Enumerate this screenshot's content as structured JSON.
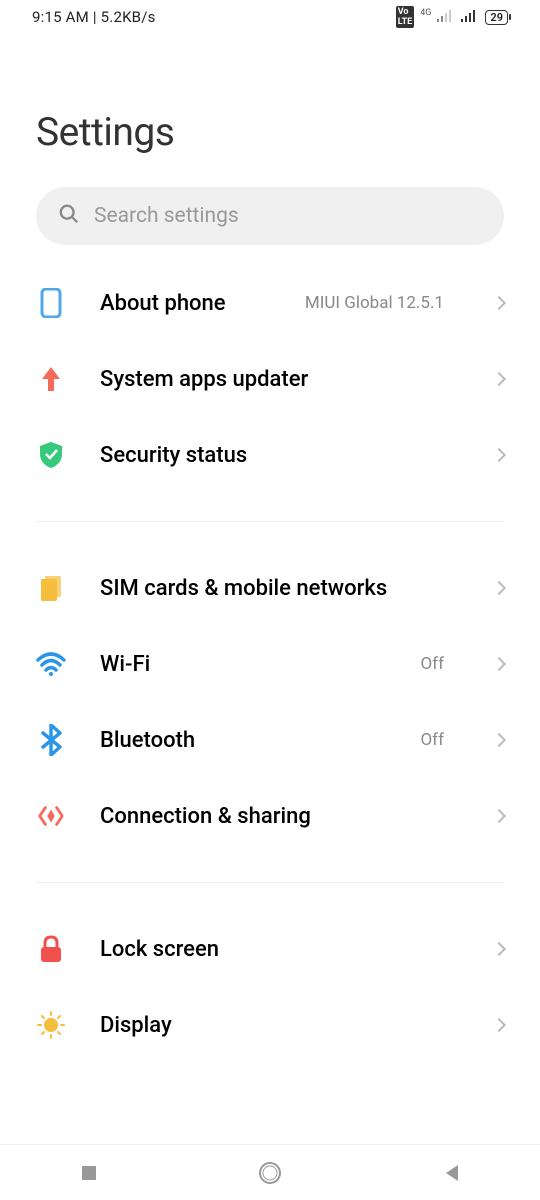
{
  "status": {
    "time": "9:15 AM",
    "speed": "5.2KB/s",
    "battery": "29",
    "network": "4G",
    "volte": "VoLTE"
  },
  "header": {
    "title": "Settings"
  },
  "search": {
    "placeholder": "Search settings"
  },
  "groups": [
    {
      "items": [
        {
          "icon": "phone",
          "label": "About phone",
          "value": "MIUI Global 12.5.1"
        },
        {
          "icon": "update",
          "label": "System apps updater",
          "value": ""
        },
        {
          "icon": "shield",
          "label": "Security status",
          "value": ""
        }
      ]
    },
    {
      "items": [
        {
          "icon": "sim",
          "label": "SIM cards & mobile networks",
          "value": ""
        },
        {
          "icon": "wifi",
          "label": "Wi-Fi",
          "value": "Off"
        },
        {
          "icon": "bluetooth",
          "label": "Bluetooth",
          "value": "Off"
        },
        {
          "icon": "connection",
          "label": "Connection & sharing",
          "value": ""
        }
      ]
    },
    {
      "items": [
        {
          "icon": "lock",
          "label": "Lock screen",
          "value": ""
        },
        {
          "icon": "display",
          "label": "Display",
          "value": ""
        }
      ]
    }
  ]
}
